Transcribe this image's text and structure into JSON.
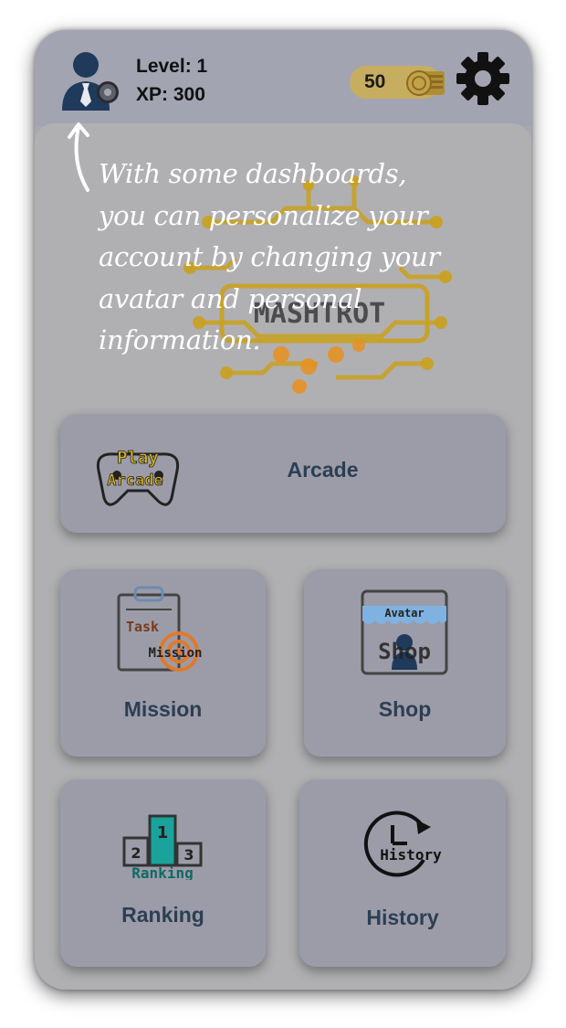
{
  "header": {
    "level_text": "Level: 1",
    "xp_text": "XP: 300",
    "coins": "50"
  },
  "logo": {
    "text": "MASHTROT"
  },
  "tooltip": {
    "lines": [
      "With some dashboards,",
      "you can personalize your",
      "account by changing your",
      "avatar and personal",
      "information."
    ]
  },
  "cards": {
    "arcade": {
      "label": "Arcade",
      "icon_text": [
        "Play",
        "Arcade"
      ]
    },
    "mission": {
      "label": "Mission",
      "icon_text": [
        "Task",
        "Mission"
      ]
    },
    "shop": {
      "label": "Shop",
      "icon_text": [
        "Avatar",
        "Shop"
      ]
    },
    "ranking": {
      "label": "Ranking",
      "icon_text": [
        "Ranking",
        "1",
        "2",
        "3"
      ]
    },
    "history": {
      "label": "History",
      "icon_text": [
        "History"
      ]
    }
  },
  "icons": {
    "user": "user-gear-icon",
    "coin": "coin-stack-icon",
    "settings": "gear-icon"
  },
  "colors": {
    "overlay_bg": "#a8a8b2",
    "card_bg": "#9c9ca9",
    "card_label": "#2c3f52",
    "coin_pill": "#c7ad5f",
    "tooltip_text": "#ffffff",
    "logo_gold": "#c9a11f",
    "logo_orange": "#e8911e"
  }
}
